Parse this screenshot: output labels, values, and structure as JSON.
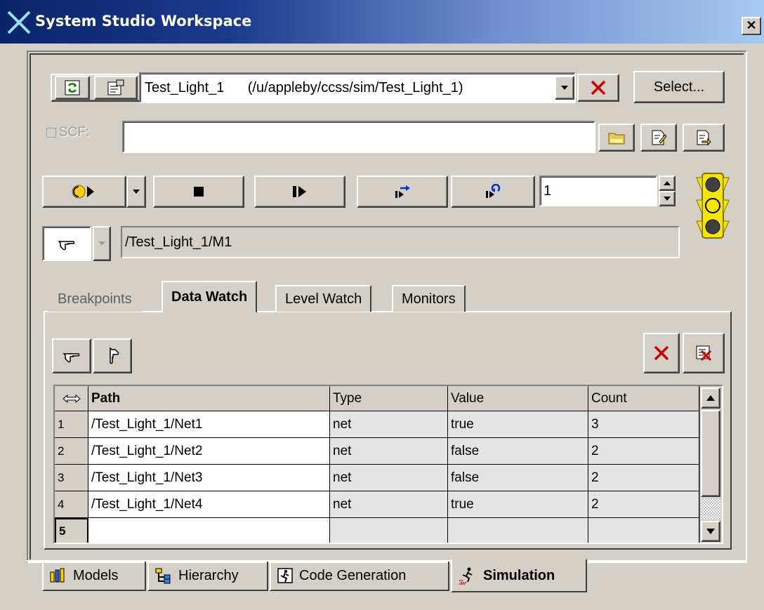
{
  "window": {
    "title": "System Studio Workspace",
    "close_glyph": "✕"
  },
  "model_bar": {
    "selected_model": "Test_Light_1      (/u/appleby/ccss/sim/Test_Light_1)",
    "select_label": "Select..."
  },
  "scf": {
    "label": "SCF:",
    "value": "",
    "checked": false
  },
  "sim_controls": {
    "step_count": "1"
  },
  "instance": {
    "path": "/Test_Light_1/M1"
  },
  "tabs": [
    {
      "label": "Breakpoints",
      "active": false
    },
    {
      "label": "Data Watch",
      "active": true
    },
    {
      "label": "Level Watch",
      "active": false
    },
    {
      "label": "Monitors",
      "active": false
    }
  ],
  "table": {
    "columns": [
      "Path",
      "Type",
      "Value",
      "Count"
    ],
    "rows": [
      {
        "num": "1",
        "path": "/Test_Light_1/Net1",
        "type": "net",
        "value": "true",
        "count": "3"
      },
      {
        "num": "2",
        "path": "/Test_Light_1/Net2",
        "type": "net",
        "value": "false",
        "count": "2"
      },
      {
        "num": "3",
        "path": "/Test_Light_1/Net3",
        "type": "net",
        "value": "false",
        "count": "2"
      },
      {
        "num": "4",
        "path": "/Test_Light_1/Net4",
        "type": "net",
        "value": "true",
        "count": "2"
      },
      {
        "num": "5",
        "path": "",
        "type": "",
        "value": "",
        "count": ""
      }
    ]
  },
  "bottom_tabs": [
    {
      "label": "Models",
      "icon": "models-icon",
      "active": false
    },
    {
      "label": "Hierarchy",
      "icon": "hierarchy-icon",
      "active": false
    },
    {
      "label": "Code Generation",
      "icon": "code-generation-icon",
      "active": false
    },
    {
      "label": "Simulation",
      "icon": "simulation-icon",
      "active": true
    }
  ],
  "colors": {
    "title_start": "#0a246a",
    "title_end": "#a6caf0",
    "face": "#d4d0c8",
    "delete_red": "#cc0000",
    "traffic_yellow": "#f5e600"
  }
}
